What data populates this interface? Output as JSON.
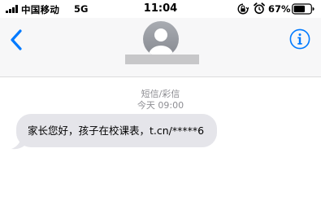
{
  "status_bar": {
    "carrier": "中国移动",
    "network": "5G",
    "time": "11:04",
    "battery_percent": "67%",
    "icons": [
      "signal-bars-icon",
      "orientation-lock-icon",
      "alarm-icon",
      "battery-icon"
    ]
  },
  "header": {
    "back_icon": "chevron-left-icon",
    "avatar_icon": "default-contact-avatar-icon",
    "info_icon": "info-circle-icon",
    "accent_color": "#007aff"
  },
  "conversation": {
    "message_type": "短信/彩信",
    "timestamp": "今天 09:00",
    "messages": [
      {
        "direction": "incoming",
        "text": "家长您好，孩子在校课表，t.cn/*****6"
      }
    ]
  },
  "colors": {
    "bubble_incoming": "#e5e5ea",
    "meta_text": "#8e8e93",
    "header_bg": "#f7f7f8"
  }
}
